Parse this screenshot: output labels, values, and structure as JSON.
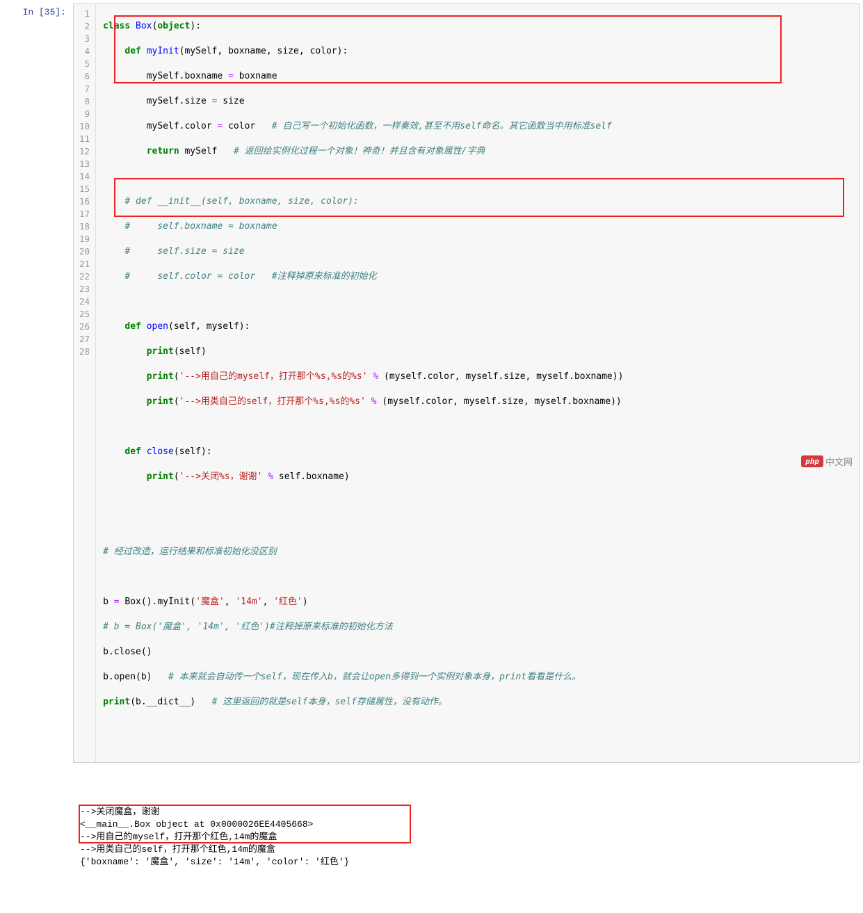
{
  "prompt": "In [35]:",
  "lineNumbers": [
    "1",
    "2",
    "3",
    "4",
    "5",
    "6",
    "7",
    "8",
    "9",
    "10",
    "11",
    "12",
    "13",
    "14",
    "15",
    "16",
    "17",
    "18",
    "19",
    "20",
    "21",
    "22",
    "23",
    "24",
    "25",
    "26",
    "27",
    "28"
  ],
  "code": {
    "l1": [
      "class",
      " ",
      "Box",
      "(",
      "object",
      "):"
    ],
    "l2": [
      "    ",
      "def",
      " ",
      "myInit",
      "(mySelf, boxname, size, color):"
    ],
    "l3": [
      "        mySelf.boxname ",
      "=",
      " boxname"
    ],
    "l4": [
      "        mySelf.size ",
      "=",
      " size"
    ],
    "l5_a": "        mySelf.color ",
    "l5_b": "=",
    "l5_c": " color   ",
    "l5_comment": "# 自己写一个初始化函数，一样奏效,甚至不用self命名。其它函数当中用标准self",
    "l6_a": "        ",
    "l6_kw": "return",
    "l6_b": " mySelf   ",
    "l6_comment": "# 返回给实例化过程一个对象！神奇！并且含有对象属性/字典",
    "l8": "    # def __init__(self, boxname, size, color):",
    "l9": "    #     self.boxname = boxname",
    "l10": "    #     self.size = size",
    "l11": "    #     self.color = color   #注释掉原来标准的初始化",
    "l13_a": "    ",
    "l13_kw": "def",
    "l13_b": " ",
    "l13_name": "open",
    "l13_c": "(self, myself):",
    "l14_a": "        ",
    "l14_kw": "print",
    "l14_b": "(self)",
    "l15_a": "        ",
    "l15_kw": "print",
    "l15_b": "(",
    "l15_str": "'-->用自己的myself，打开那个%s,%s的%s'",
    "l15_c": " ",
    "l15_op": "%",
    "l15_d": " (myself.color, myself.size, myself.boxname))",
    "l16_a": "        ",
    "l16_kw": "print",
    "l16_b": "(",
    "l16_str": "'-->用类自己的self，打开那个%s,%s的%s'",
    "l16_c": " ",
    "l16_op": "%",
    "l16_d": " (myself.color, myself.size, myself.boxname))",
    "l18_a": "    ",
    "l18_kw": "def",
    "l18_b": " ",
    "l18_name": "close",
    "l18_c": "(self):",
    "l19_a": "        ",
    "l19_kw": "print",
    "l19_b": "(",
    "l19_str": "'-->关闭%s，谢谢'",
    "l19_c": " ",
    "l19_op": "%",
    "l19_d": " self.boxname)",
    "l22": "# 经过改造，运行结果和标准初始化没区别",
    "l24_a": "b ",
    "l24_op": "=",
    "l24_b": " Box().myInit(",
    "l24_s1": "'魔盒'",
    "l24_c": ", ",
    "l24_s2": "'14m'",
    "l24_d": ", ",
    "l24_s3": "'红色'",
    "l24_e": ")",
    "l25": "# b = Box('魔盒', '14m', '红色')#注释掉原来标准的初始化方法",
    "l26": "b.close()",
    "l27_a": "b.open(b)   ",
    "l27_comment": "# 本来就会自动传一个self，现在传入b，就会让open多得到一个实例对象本身，print看看是什么。",
    "l28_a": "print",
    "l28_b": "(b.__dict__)   ",
    "l28_comment": "# 这里返回的就是self本身，self存储属性，没有动作。"
  },
  "output": {
    "o1": "-->关闭魔盒，谢谢",
    "o2": "<__main__.Box object at 0x0000026EE4405668>",
    "o3": "-->用自己的myself，打开那个红色,14m的魔盒",
    "o4": "-->用类自己的self，打开那个红色,14m的魔盒",
    "o5": "{'boxname': '魔盒', 'size': '14m', 'color': '红色'}"
  },
  "watermark": {
    "badge": "php",
    "text": "中文网"
  }
}
